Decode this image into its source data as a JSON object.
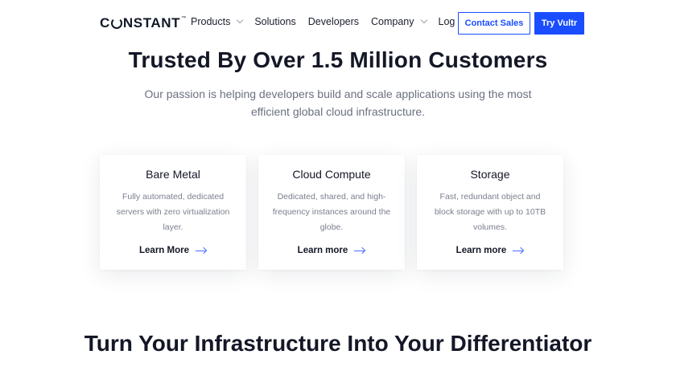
{
  "nav": {
    "logo_prefix": "C",
    "logo_suffix": "NSTANT",
    "logo_tm": "™",
    "products": "Products",
    "solutions": "Solutions",
    "developers": "Developers",
    "company": "Company",
    "login": "Log In",
    "contact_sales": "Contact Sales",
    "try": "Try Vultr",
    "accent_color": "#1a4dff"
  },
  "hero": {
    "title": "Trusted By Over 1.5 Million Customers",
    "subtitle": "Our passion is helping developers build and scale applications using the most efficient global cloud infrastructure."
  },
  "cards": [
    {
      "title": "Bare Metal",
      "description": "Fully automated, dedicated servers with zero virtualization layer.",
      "link": "Learn More"
    },
    {
      "title": "Cloud Compute",
      "description": "Dedicated, shared, and high-frequency instances around the globe.",
      "link": "Learn more"
    },
    {
      "title": "Storage",
      "description": "Fast, redundant object and block storage with up to 10TB volumes.",
      "link": "Learn more"
    }
  ],
  "section2": {
    "title": "Turn Your Infrastructure Into Your Differentiator"
  }
}
